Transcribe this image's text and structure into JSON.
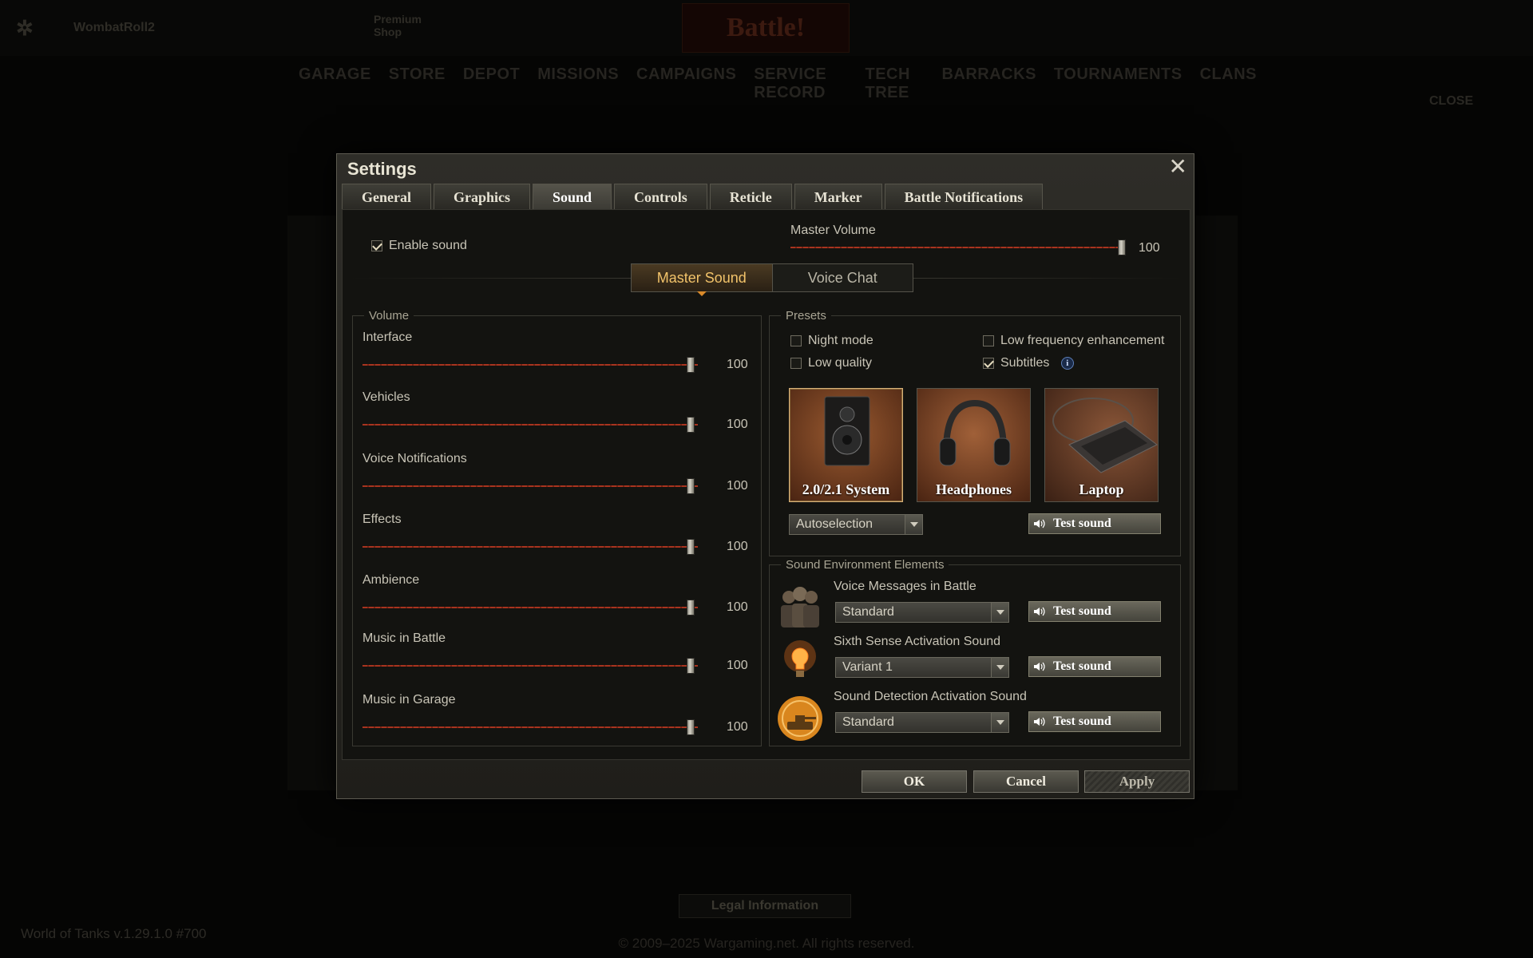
{
  "background": {
    "player": "WombatRoll2",
    "premium_shop": "Premium Shop",
    "battle_label": "Battle!",
    "nav": [
      "GARAGE",
      "STORE",
      "DEPOT",
      "MISSIONS",
      "CAMPAIGNS",
      "SERVICE RECORD",
      "TECH TREE",
      "BARRACKS",
      "TOURNAMENTS",
      "CLANS"
    ],
    "close_label": "CLOSE",
    "legal_button": "Legal Information",
    "copyright": "© 2009–2025 Wargaming.net. All rights reserved.",
    "version": "World of Tanks v.1.29.1.0 #700"
  },
  "dialog": {
    "title": "Settings",
    "tabs": [
      "General",
      "Graphics",
      "Sound",
      "Controls",
      "Reticle",
      "Marker",
      "Battle Notifications"
    ],
    "active_tab": "Sound",
    "enable_sound": {
      "label": "Enable sound",
      "checked": true
    },
    "master_volume": {
      "label": "Master Volume",
      "value": "100"
    },
    "switcher": {
      "master": "Master Sound",
      "voice": "Voice Chat",
      "selected": "Master Sound"
    },
    "volume": {
      "title": "Volume",
      "sliders": [
        {
          "label": "Interface",
          "value": "100"
        },
        {
          "label": "Vehicles",
          "value": "100"
        },
        {
          "label": "Voice Notifications",
          "value": "100"
        },
        {
          "label": "Effects",
          "value": "100"
        },
        {
          "label": "Ambience",
          "value": "100"
        },
        {
          "label": "Music in Battle",
          "value": "100"
        },
        {
          "label": "Music in Garage",
          "value": "100"
        }
      ]
    },
    "presets": {
      "title": "Presets",
      "night_mode": {
        "label": "Night mode",
        "checked": false
      },
      "low_freq": {
        "label": "Low frequency enhancement",
        "checked": false
      },
      "low_quality": {
        "label": "Low quality",
        "checked": false
      },
      "subtitles": {
        "label": "Subtitles",
        "checked": true
      },
      "cards": [
        {
          "label": "2.0/2.1 System",
          "selected": true
        },
        {
          "label": "Headphones",
          "selected": false
        },
        {
          "label": "Laptop",
          "selected": false
        }
      ],
      "output_select": "Autoselection",
      "test_sound": "Test sound"
    },
    "environment": {
      "title": "Sound Environment Elements",
      "items": [
        {
          "label": "Voice Messages in Battle",
          "selected": "Standard",
          "button": "Test sound"
        },
        {
          "label": "Sixth Sense Activation Sound",
          "selected": "Variant 1",
          "button": "Test sound"
        },
        {
          "label": "Sound Detection Activation Sound",
          "selected": "Standard",
          "button": "Test sound"
        }
      ]
    },
    "buttons": {
      "ok": "OK",
      "cancel": "Cancel",
      "apply": "Apply"
    }
  },
  "colors": {
    "accent": "#f2c36a",
    "slider": "#a8341f"
  }
}
